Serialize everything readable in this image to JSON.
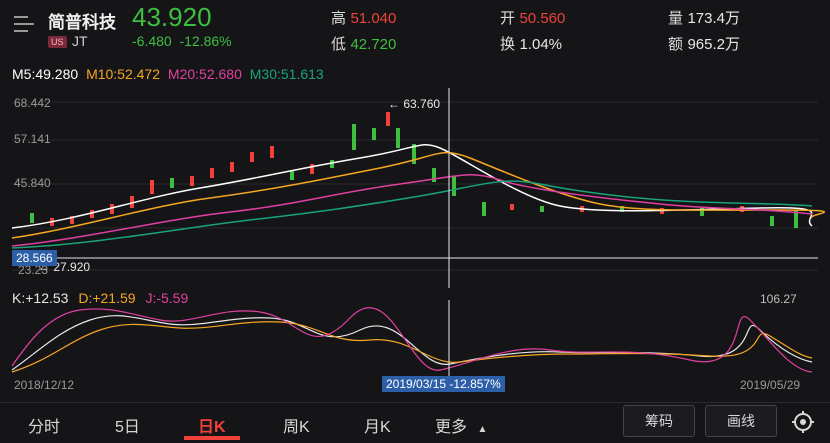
{
  "header": {
    "name": "简普科技",
    "market_badge": "US",
    "ticker": "JT",
    "price": "43.920",
    "change": "-6.480",
    "change_pct": "-12.86%",
    "high_label": "高",
    "high": "51.040",
    "low_label": "低",
    "low": "42.720",
    "open_label": "开",
    "open": "50.560",
    "turnover_label": "换",
    "turnover": "1.04%",
    "volume_label": "量",
    "volume": "173.4万",
    "amount_label": "额",
    "amount": "965.2万"
  },
  "ma": {
    "m5": "M5:49.280",
    "m10": "M10:52.472",
    "m20": "M20:52.680",
    "m30": "M30:51.613"
  },
  "axis": {
    "y_top": "68.442",
    "y_mid": "57.141",
    "y_low": "45.840",
    "y_bottom": "23.23",
    "max_label": "63.760",
    "min_label": "27.920",
    "crosshair_price": "28.566",
    "kdj_top": "106.27",
    "date_start": "2018/12/12",
    "date_end": "2019/05/29",
    "crosshair_date": "2019/03/15  -12.857%"
  },
  "kdj": {
    "k": "K:+12.53",
    "d": "D:+21.59",
    "j": "J:-5.59"
  },
  "tabs": [
    "分时",
    "5日",
    "日K",
    "周K",
    "月K",
    "更多"
  ],
  "buttons": {
    "chip": "筹码",
    "draw": "画线"
  },
  "colors": {
    "up": "#f0413a",
    "down": "#3fbf3f",
    "ma5": "#ffffff",
    "ma10": "#f5a623",
    "ma20": "#e040a0",
    "ma30": "#1aa37a"
  }
}
